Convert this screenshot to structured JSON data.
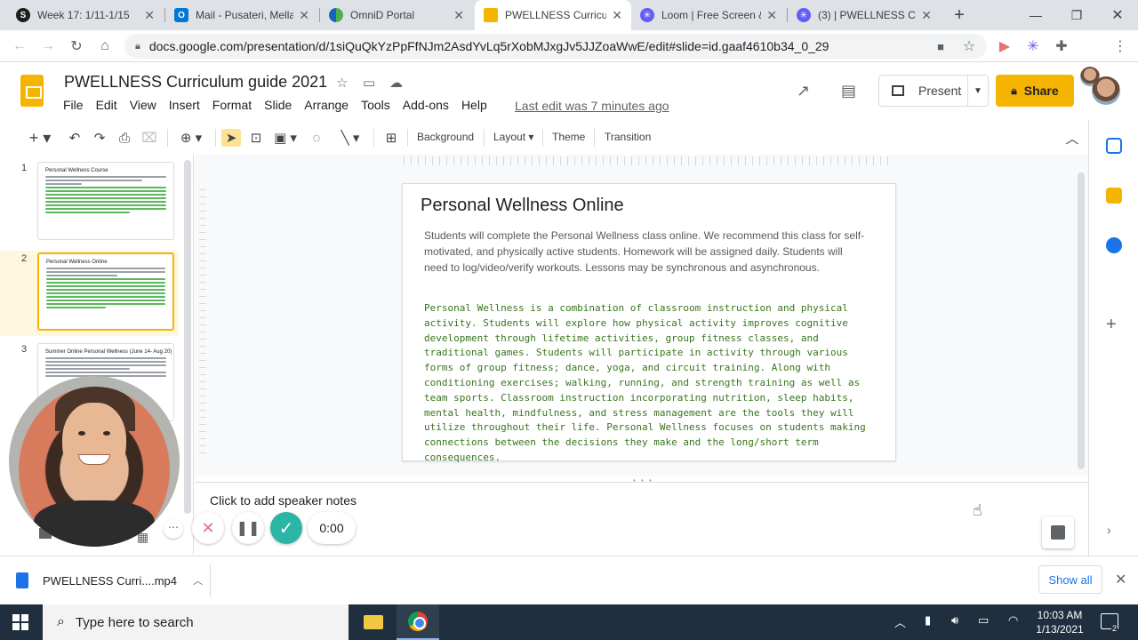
{
  "browser": {
    "tabs": [
      {
        "title": "Week 17: 1/11-1/15",
        "favicon": "schoology-icon",
        "color": "#1e88e5",
        "glyph": "S"
      },
      {
        "title": "Mail - Pusateri, Mella",
        "favicon": "outlook-icon",
        "color": "#0078d4",
        "glyph": "O"
      },
      {
        "title": "OmniD Portal",
        "favicon": "omnid-icon",
        "color": "#4caf50",
        "glyph": ""
      },
      {
        "title": "PWELLNESS Curricul",
        "favicon": "slides-icon",
        "color": "#f4b400",
        "glyph": ""
      },
      {
        "title": "Loom | Free Screen &",
        "favicon": "loom-icon",
        "color": "#625df5",
        "glyph": "✳"
      },
      {
        "title": "(3) | PWELLNESS Cur",
        "favicon": "loom-icon",
        "color": "#625df5",
        "glyph": "✳"
      }
    ],
    "url": "docs.google.com/presentation/d/1siQuQkYzPpFfNJm2AsdYvLq5rXobMJxgJv5JJZoaWwE/edit#slide=id.gaaf4610b34_0_29"
  },
  "docs": {
    "title": "PWELLNESS  Curriculum guide 2021",
    "menu": [
      "File",
      "Edit",
      "View",
      "Insert",
      "Format",
      "Slide",
      "Arrange",
      "Tools",
      "Add-ons",
      "Help"
    ],
    "last_edit": "Last edit was 7 minutes ago",
    "present_label": "Present",
    "share_label": "Share",
    "accent": "#f4b400"
  },
  "toolbar": {
    "background": "Background",
    "layout": "Layout",
    "theme": "Theme",
    "transition": "Transition"
  },
  "filmstrip": {
    "slides": [
      {
        "num": "1",
        "title": "Personal Wellness Course"
      },
      {
        "num": "2",
        "title": "Personal Wellness Online"
      },
      {
        "num": "3",
        "title": "Summer Online Personal Wellness  (June 14- Aug 20)"
      }
    ]
  },
  "slide": {
    "title": "Personal Wellness Online",
    "paragraph1": "Students will complete the Personal Wellness class online. We recommend this class for self-motivated, and physically active students. Homework will be assigned daily. Students will need to log/video/verify workouts. Lessons may be synchronous and asynchronous.",
    "paragraph2": "Personal Wellness is a combination of classroom instruction and physical activity. Students will explore how physical activity improves cognitive development through lifetime activities, group fitness classes, and traditional games. Students will participate in activity through various forms of group fitness; dance, yoga, and circuit training. Along with conditioning exercises; walking, running, and strength training as well as team sports. Classroom instruction incorporating nutrition, sleep habits, mental health, mindfulness, and stress management are the tools they will utilize throughout their life. Personal Wellness focuses on students making connections between the decisions they make and the long/short term consequences.",
    "paragraph2_color": "#38761d"
  },
  "notes": {
    "placeholder": "Click to add speaker notes"
  },
  "loom": {
    "timer": "0:00"
  },
  "download": {
    "filename": "PWELLNESS Curri....mp4",
    "show_all": "Show all"
  },
  "taskbar": {
    "search_placeholder": "Type here to search",
    "time": "10:03 AM",
    "date": "1/13/2021",
    "notification_count": "2"
  }
}
